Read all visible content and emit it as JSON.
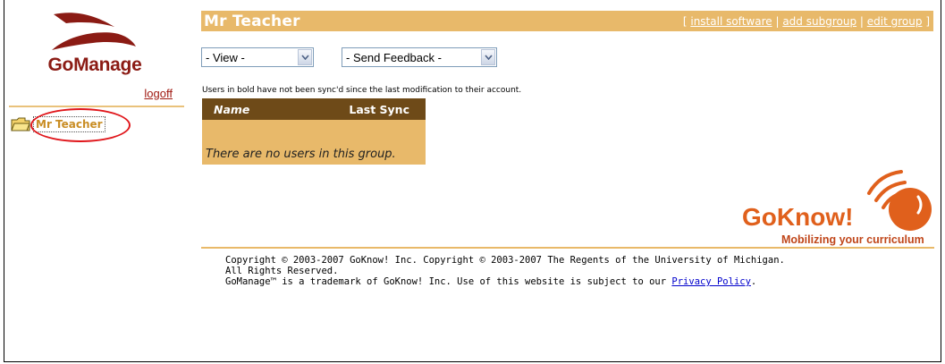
{
  "sidebar": {
    "brand": "GoManage",
    "logoff_label": "logoff",
    "tree": [
      {
        "label": "Mr Teacher",
        "icon": "folder-icon"
      }
    ]
  },
  "header": {
    "title": "Mr Teacher",
    "bracket_open": "[",
    "bracket_close": "]",
    "separator": "|",
    "links": {
      "install_software": "install software",
      "add_subgroup": "add subgroup",
      "edit_group": "edit group"
    }
  },
  "controls": {
    "view_select": {
      "selected": "- View -",
      "icon": "chevron-down-icon"
    },
    "feedback_select": {
      "selected": "- Send Feedback -",
      "icon": "chevron-down-icon"
    }
  },
  "main": {
    "info_text": "Users in bold have not been sync'd since the last modification to their account.",
    "users_table": {
      "columns": [
        "Name",
        "Last Sync"
      ],
      "empty_message": "There are no users in this group."
    }
  },
  "gk_logo": {
    "wordmark_go": "Go",
    "wordmark_know": "Know!",
    "tagline": "Mobilizing your curriculum"
  },
  "footer": {
    "copyright_line": "Copyright © 2003-2007 GoKnow! Inc. Copyright © 2003-2007 The Regents of the University of Michigan.",
    "rights_line": "All Rights Reserved.",
    "trademark_prefix": "GoManage™ is a trademark of GoKnow! Inc. Use of this website is subject to our ",
    "privacy_link": "Privacy Policy",
    "trademark_suffix": "."
  },
  "colors": {
    "header_bg": "#e8b96a",
    "table_head_bg": "#6e4a18",
    "brand_red": "#8b1b14",
    "highlight_ring": "#e0161b",
    "gk_orange": "#e0601c"
  }
}
